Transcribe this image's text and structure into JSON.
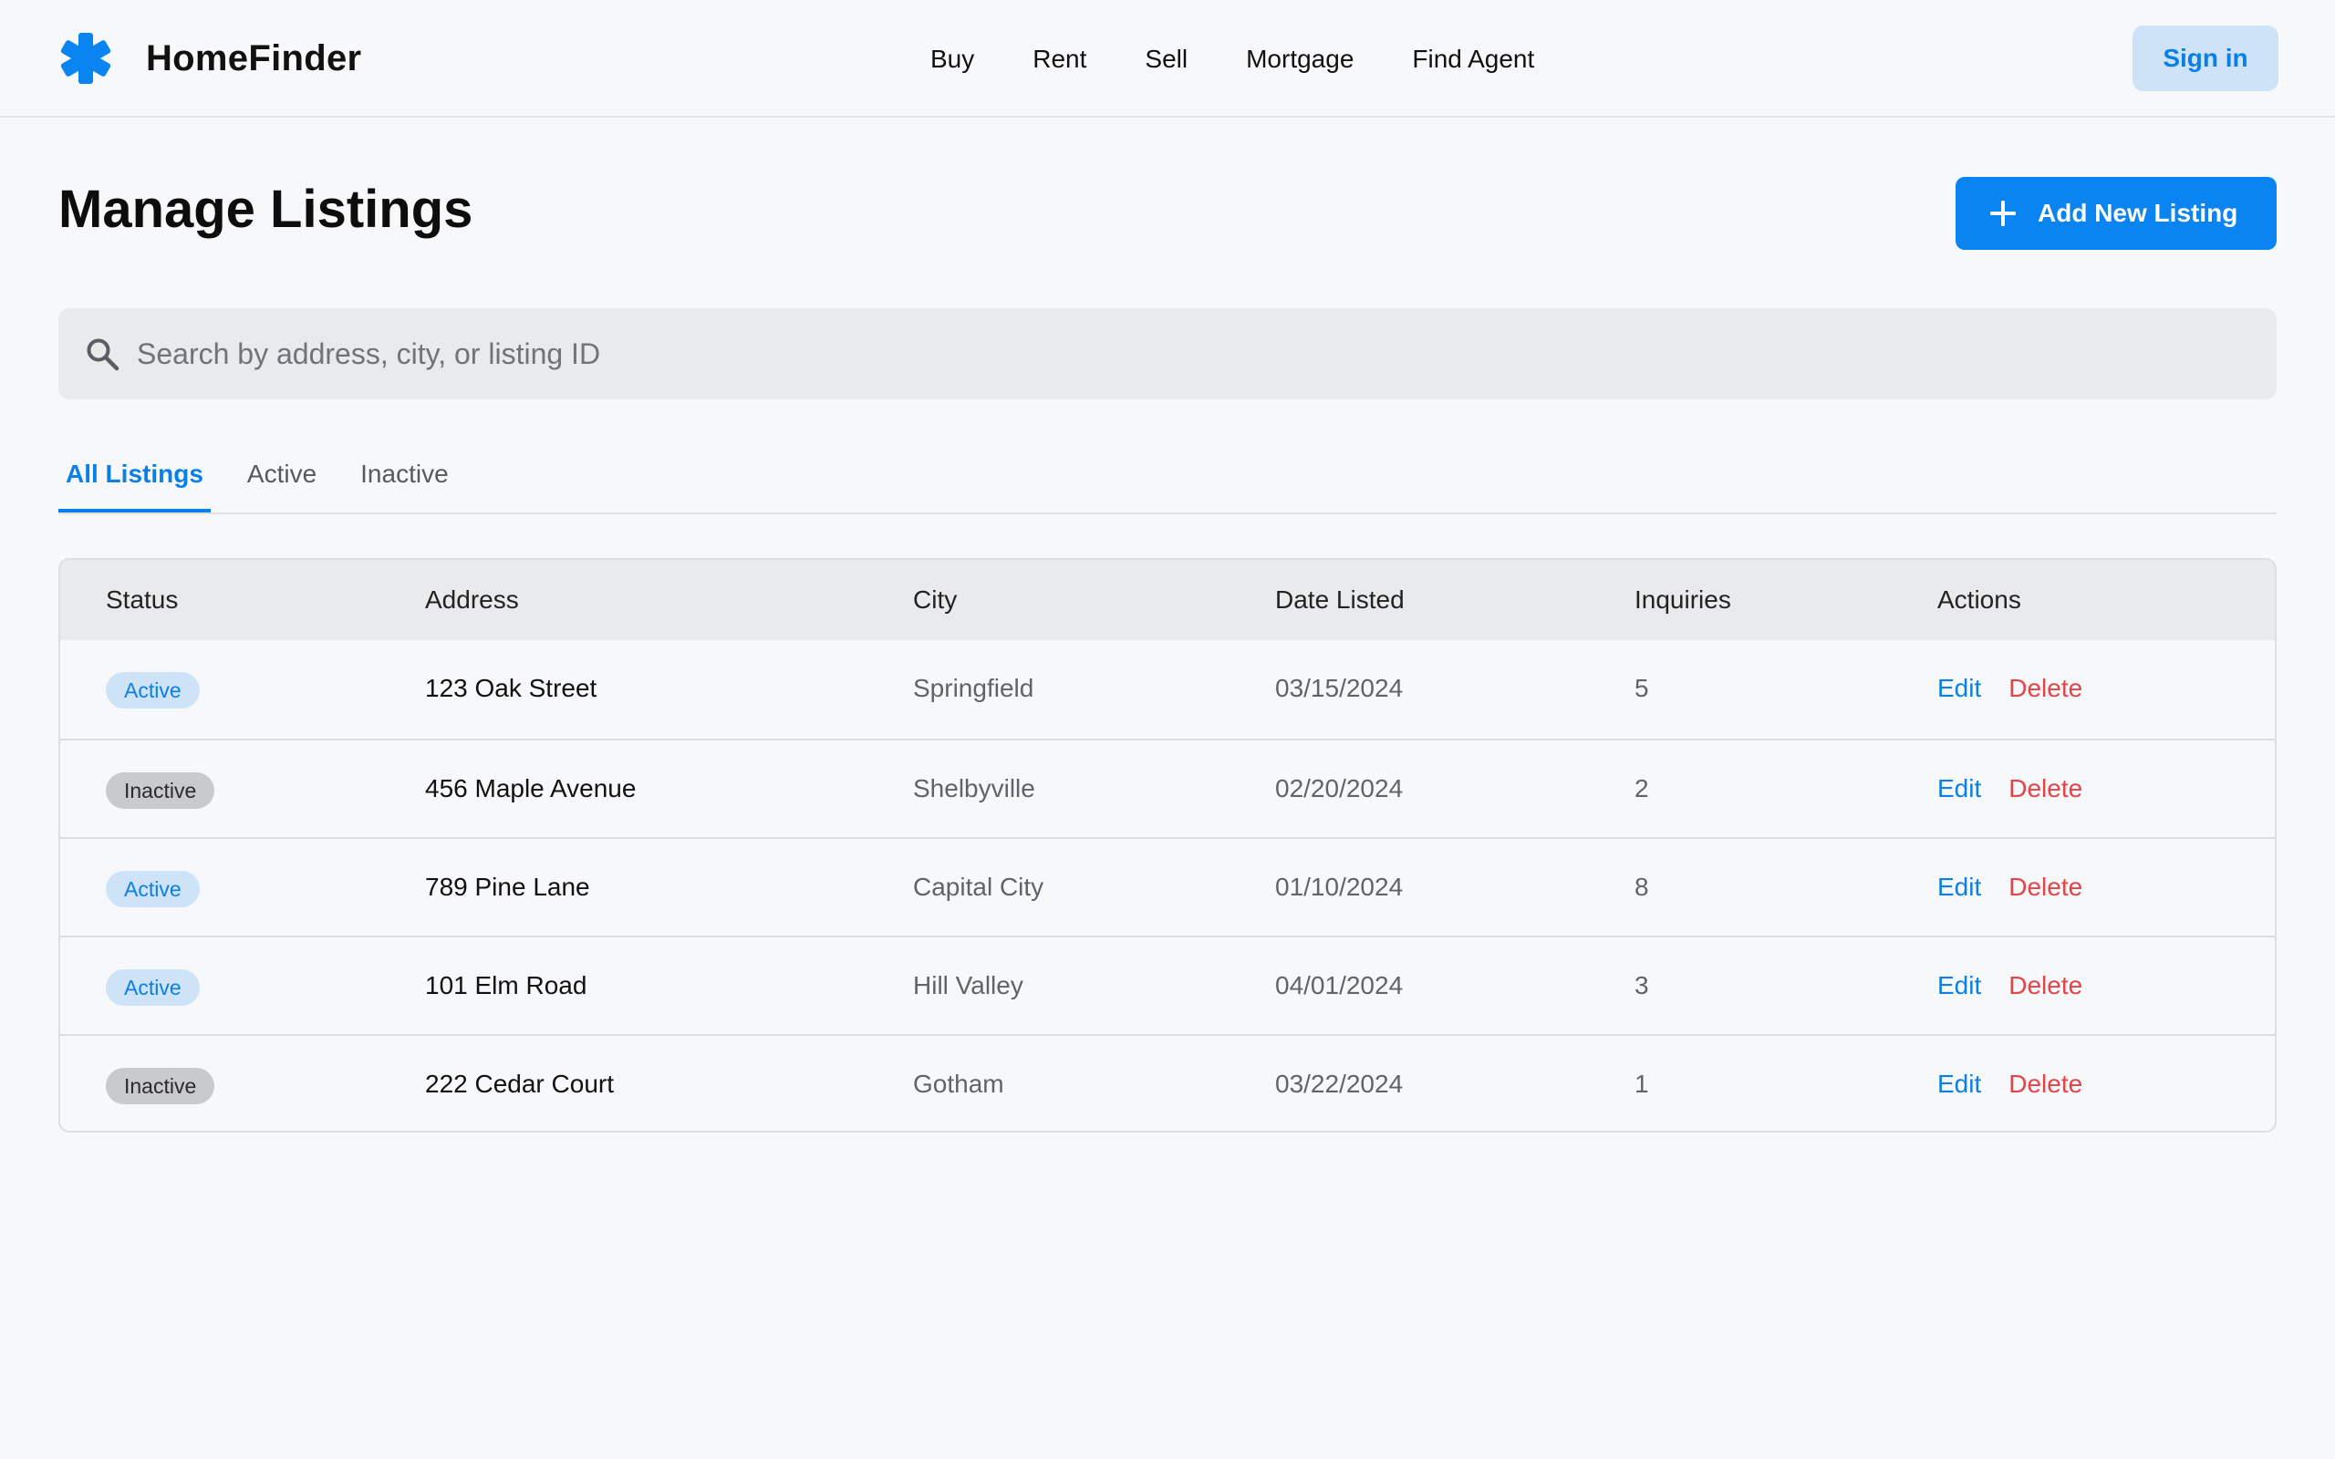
{
  "brand": {
    "name": "HomeFinder",
    "icon": "asterisk-icon",
    "accent": "#0a84f0"
  },
  "nav": {
    "items": [
      "Buy",
      "Rent",
      "Sell",
      "Mortgage",
      "Find Agent"
    ]
  },
  "header": {
    "signin_label": "Sign in"
  },
  "page": {
    "title": "Manage Listings",
    "add_button_label": "Add New Listing",
    "add_icon": "plus-icon"
  },
  "search": {
    "placeholder": "Search by address, city, or listing ID",
    "value": "",
    "icon": "search-icon"
  },
  "tabs": [
    {
      "label": "All Listings",
      "active": true
    },
    {
      "label": "Active",
      "active": false
    },
    {
      "label": "Inactive",
      "active": false
    }
  ],
  "table": {
    "columns": [
      "Status",
      "Address",
      "City",
      "Date Listed",
      "Inquiries",
      "Actions"
    ],
    "rows": [
      {
        "status": "Active",
        "address": "123 Oak Street",
        "city": "Springfield",
        "date": "03/15/2024",
        "inquiries": "5",
        "edit": "Edit",
        "delete": "Delete"
      },
      {
        "status": "Inactive",
        "address": "456 Maple Avenue",
        "city": "Shelbyville",
        "date": "02/20/2024",
        "inquiries": "2",
        "edit": "Edit",
        "delete": "Delete"
      },
      {
        "status": "Active",
        "address": "789 Pine Lane",
        "city": "Capital City",
        "date": "01/10/2024",
        "inquiries": "8",
        "edit": "Edit",
        "delete": "Delete"
      },
      {
        "status": "Active",
        "address": "101 Elm Road",
        "city": "Hill Valley",
        "date": "04/01/2024",
        "inquiries": "3",
        "edit": "Edit",
        "delete": "Delete"
      },
      {
        "status": "Inactive",
        "address": "222 Cedar Court",
        "city": "Gotham",
        "date": "03/22/2024",
        "inquiries": "1",
        "edit": "Edit",
        "delete": "Delete"
      }
    ]
  },
  "colors": {
    "primary": "#0a84f0",
    "danger": "#e2444a",
    "active_badge_bg": "#cfe3f8",
    "inactive_badge_bg": "#c9cacd"
  }
}
